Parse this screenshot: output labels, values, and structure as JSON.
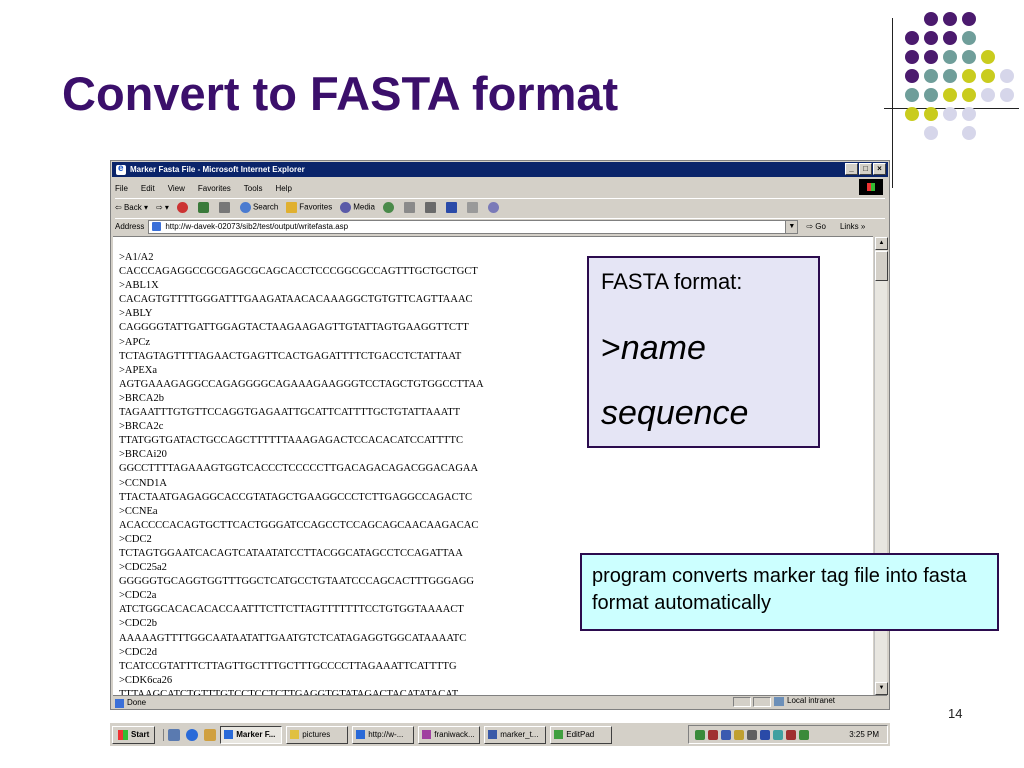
{
  "slide": {
    "title": "Convert to FASTA format",
    "number": "14",
    "colors": {
      "title": "#3b0f6b",
      "dot_purple": "#4b1a6e",
      "dot_teal": "#6f9e9a",
      "dot_yellow": "#c9cc1e",
      "dot_lavender": "#d6d6ea"
    }
  },
  "browser": {
    "window_title": "Marker Fasta File - Microsoft Internet Explorer",
    "window_buttons": [
      "_",
      "□",
      "×"
    ],
    "menu": [
      "File",
      "Edit",
      "View",
      "Favorites",
      "Tools",
      "Help"
    ],
    "toolbar": {
      "back": "Back",
      "search": "Search",
      "favorites": "Favorites",
      "media": "Media"
    },
    "address_label": "Address",
    "address_url": "http://w-davek-02073/sib2/test/output/writefasta.asp",
    "go_label": "Go",
    "links_label": "Links »",
    "status_text": "Done",
    "status_zone": "Local intranet",
    "content_lines": [
      ">A1/A2",
      "CACCCAGAGGCCGCGAGCGCAGCACCTCCCGGCGCCAGTTTGCTGCTGCT",
      ">ABL1X",
      "CACAGTGTTTTGGGATTTGAAGATAACACAAAGGCTGTGTTCAGTTAAAC",
      ">ABLY",
      "CAGGGGTATTGATTGGAGTACTAAGAAGAGTTGTATTAGTGAAGGTTCTT",
      ">APCz",
      "TCTAGTAGTTTTAGAACTGAGTTCACTGAGATTTTCTGACCTCTATTAAT",
      ">APEXa",
      "AGTGAAAGAGGCCAGAGGGGCAGAAAGAAGGGTCCTAGCTGTGGCCTTAA",
      ">BRCA2b",
      "TAGAATTTGTGTTCCAGGTGAGAATTGCATTCATTTTGCTGTATTAAATT",
      ">BRCA2c",
      "TTATGGTGATACTGCCAGCTTTTTTAAAGAGACTCCACACATCCATTTTC",
      ">BRCAi20",
      "GGCCTTTTAGAAAGTGGTCACCCTCCCCCTTGACAGACAGACGGACAGAA",
      ">CCND1A",
      "TTACTAATGAGAGGCACCGTATAGCTGAAGGCCCTCTTGAGGCCAGACTC",
      ">CCNEa",
      "ACACCCCACAGTGCTTCACTGGGATCCAGCCTCCAGCAGCAACAAGACAC",
      ">CDC2",
      "TCTAGTGGAATCACAGTCATAATATCCTTACGGCATAGCCTCCAGATTAA",
      ">CDC25a2",
      "GGGGGTGCAGGTGGTTTGGCTCATGCCTGTAATCCCAGCACTTTGGGAGG",
      ">CDC2a",
      "ATCTGGCACACACACCAATTTCTTCTTAGTTTTTTTCCTGTGGTAAAACT",
      ">CDC2b",
      "AAAAAGTTTTGGCAATAATATTGAATGTCTCATAGAGGTGGCATAAAATC",
      ">CDC2d",
      "TCATCCGTATTTCTTAGTTGCTTTGCTTTGCCCCTTAGAAATTCATTTTG",
      ">CDK6ca26",
      "TTTAAGCATCTGTTTGTCCTCCTCTTGAGGTGTATAGACTACATATACAT"
    ]
  },
  "taskbar": {
    "start_label": "Start",
    "tasks": [
      "Marker F...",
      "pictures",
      "http://w-...",
      "franiwack...",
      "marker_t...",
      "EditPad"
    ],
    "clock": "3:25 PM"
  },
  "callout_fasta": {
    "heading": "FASTA format:",
    "gt": ">",
    "name": "name",
    "sequence": "sequence"
  },
  "callout_note": {
    "text": "program converts marker tag file into fasta format automatically"
  }
}
